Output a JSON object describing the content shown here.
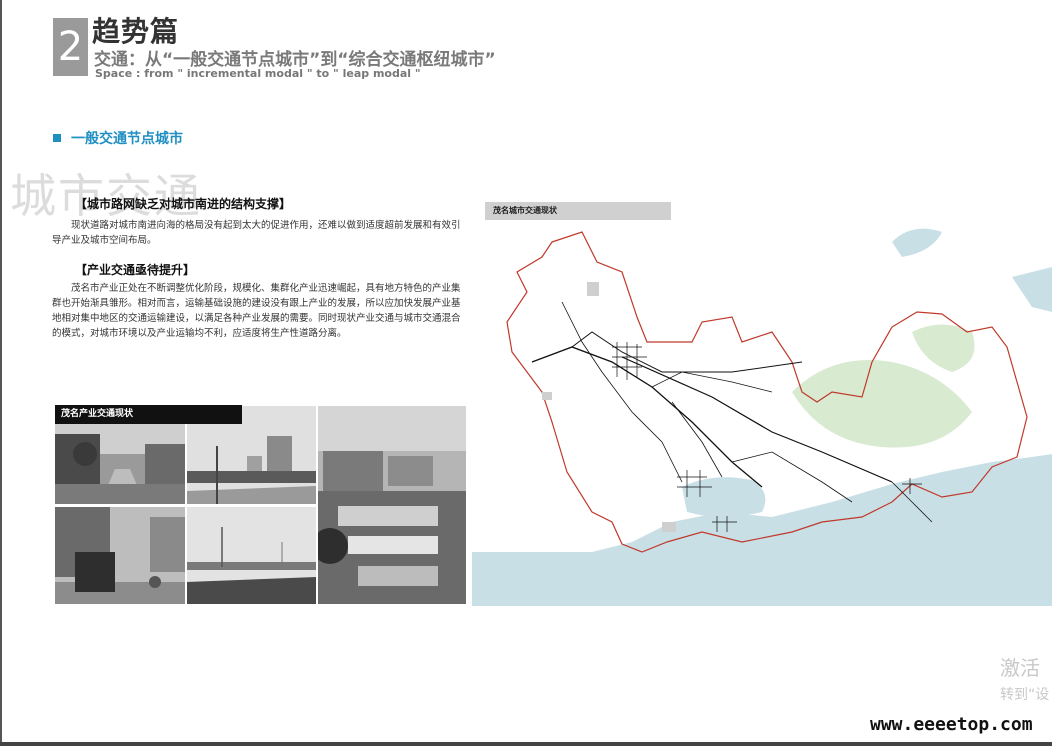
{
  "header": {
    "section_number": "2",
    "title": "趋势篇",
    "subtitle": "交通：从“一般交通节点城市”到“综合交通枢纽城市”",
    "subtitle_en": "Space : from \" incremental modal \" to \" leap modal \""
  },
  "section": {
    "heading": "一般交通节点城市",
    "watermark": "城市交通",
    "accent_color": "#1f8fc2"
  },
  "body": {
    "heading_1": "【城市路网缺乏对城市南进的结构支撑】",
    "paragraph_1": "现状道路对城市南进向海的格局没有起到太大的促进作用，还难以做到适度超前发展和有效引导产业及城市空间布局。",
    "heading_2": "【产业交通亟待提升】",
    "paragraph_2": "茂名市产业正处在不断调整优化阶段，规模化、集群化产业迅速崛起，具有地方特色的产业集群也开始渐具雏形。相对而言，运输基础设施的建设没有跟上产业的发展，所以应加快发展产业基地相对集中地区的交通运输建设，以满足各种产业发展的需要。同时现状产业交通与城市交通混合的模式，对城市环境以及产业运输均不利，应适度将生产性道路分离。"
  },
  "photos": {
    "label": "茂名产业交通现状"
  },
  "map": {
    "label": "茂名城市交通现状",
    "boundary_color": "#c0392b",
    "sea_color": "#c8dfe6",
    "green_color": "#d8ead0"
  },
  "overlay": {
    "activate_line_1": "激活",
    "activate_line_2": "转到“设",
    "site": "www.eeeetop.com"
  }
}
